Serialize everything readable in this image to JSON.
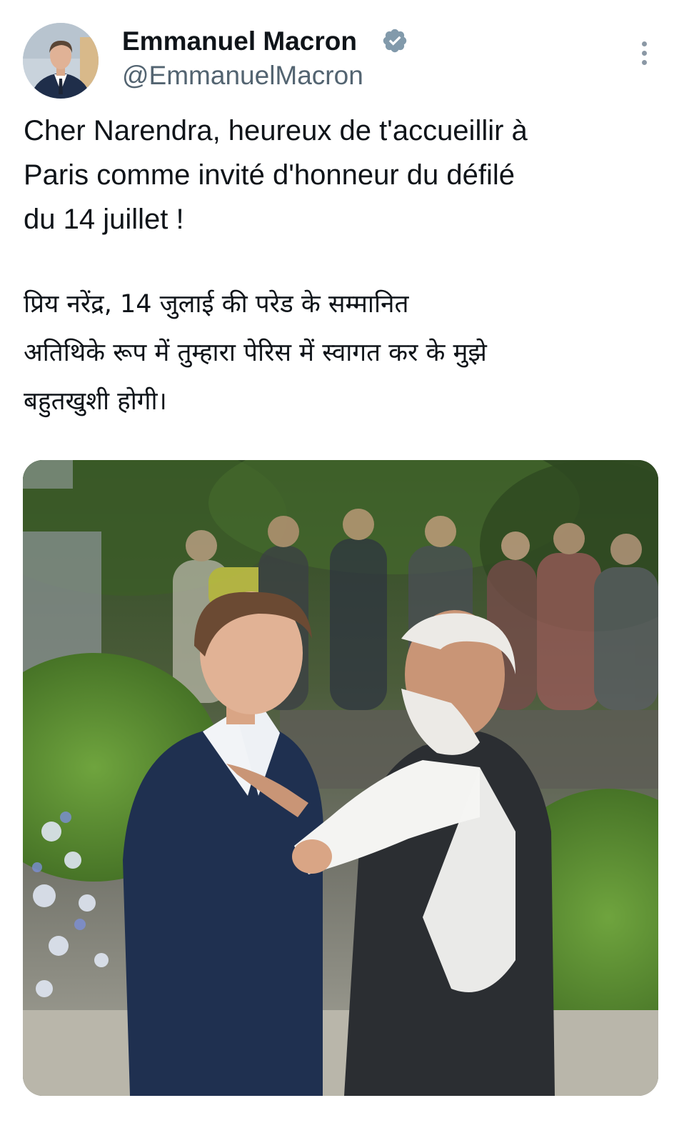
{
  "author": {
    "name": "Emmanuel Macron",
    "handle": "@EmmanuelMacron",
    "verified": true,
    "verified_color": "#829aab"
  },
  "tweet": {
    "text_fr": "Cher Narendra, heureux de t'accueillir à\nParis comme invité d'honneur du défilé\ndu 14 juillet !",
    "text_hi": "प्रिय नरेंद्र, 14 जुलाई की परेड के सम्मानित\nअतिथिके रूप में तुम्हारा पेरिस में स्वागत कर के मुझे\nबहुतखुशी होगी।"
  },
  "icons": {
    "more": "more-vertical-icon",
    "verified": "verified-badge-icon"
  }
}
